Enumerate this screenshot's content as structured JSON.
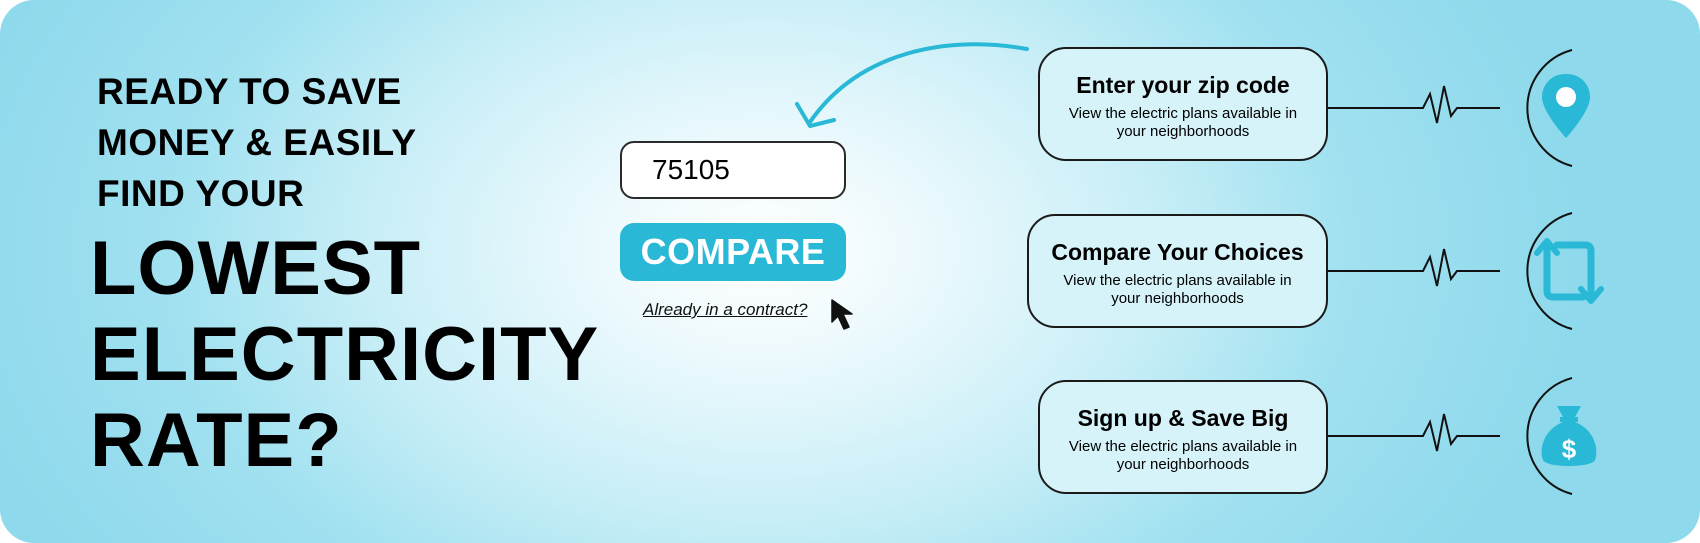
{
  "headline": {
    "small": "READY TO SAVE\nMONEY & EASILY\nFIND YOUR",
    "big": "LOWEST\nELECTRICITY\nRATE?"
  },
  "form": {
    "zip_value": "75105",
    "compare_label": "COMPARE",
    "contract_link": "Already in a contract?"
  },
  "steps": [
    {
      "title": "Enter your zip code",
      "description": "View the electric plans available in your neighborhoods",
      "icon": "location-pin-icon"
    },
    {
      "title": "Compare Your Choices",
      "description": "View the electric plans available in your neighborhoods",
      "icon": "compare-arrows-icon"
    },
    {
      "title": "Sign up & Save Big",
      "description": "View the electric plans available in your neighborhoods",
      "icon": "money-bag-icon"
    }
  ],
  "colors": {
    "accent": "#29b8d6",
    "background": "#a1e1f0",
    "text": "#000000"
  }
}
